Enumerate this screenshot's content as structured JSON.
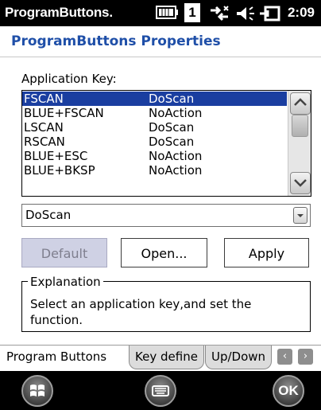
{
  "status_bar": {
    "app_title": "ProgramButtons",
    "ellipsis": ".",
    "badge": "1",
    "time": "2:09",
    "icons": [
      "battery-bar-icon",
      "count-badge",
      "connectivity-icon",
      "speaker-icon",
      "power-plug-icon"
    ]
  },
  "page": {
    "title": "ProgramButtons Properties"
  },
  "application_key": {
    "label": "Application Key:",
    "rows": [
      {
        "key": "FSCAN",
        "action": "DoScan",
        "selected": true
      },
      {
        "key": "BLUE+FSCAN",
        "action": "NoAction",
        "selected": false
      },
      {
        "key": "LSCAN",
        "action": "DoScan",
        "selected": false
      },
      {
        "key": "RSCAN",
        "action": "DoScan",
        "selected": false
      },
      {
        "key": "BLUE+ESC",
        "action": "NoAction",
        "selected": false
      },
      {
        "key": "BLUE+BKSP",
        "action": "NoAction",
        "selected": false
      }
    ]
  },
  "action_combo": {
    "value": "DoScan"
  },
  "buttons": {
    "default": "Default",
    "open": "Open...",
    "apply": "Apply"
  },
  "explanation": {
    "title": "Explanation",
    "text": "Select an application key,and set the function."
  },
  "tabs": [
    {
      "label": "Program Buttons",
      "active": true
    },
    {
      "label": "Key define",
      "active": false
    },
    {
      "label": "Up/Down",
      "active": false
    }
  ],
  "bottom_bar": {
    "ok_label": "OK",
    "left": "windows-start-icon",
    "center": "keyboard-icon"
  },
  "colors": {
    "selection": "#1a3ea0",
    "title": "#1f4fa8",
    "disabled_button": "#cfd1e4"
  }
}
